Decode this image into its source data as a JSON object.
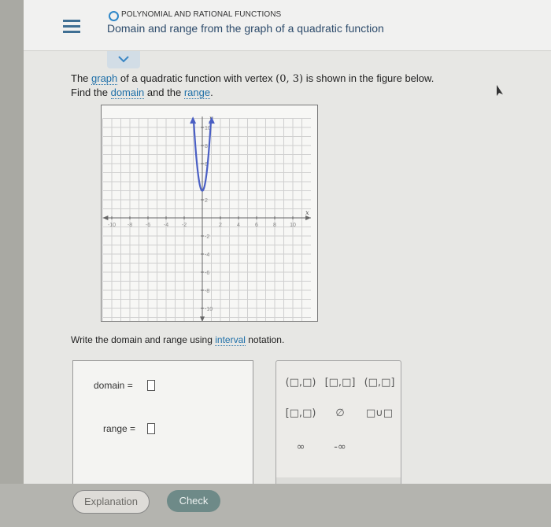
{
  "header": {
    "topic": "POLYNOMIAL AND RATIONAL FUNCTIONS",
    "title": "Domain and range from the graph of a quadratic function"
  },
  "question": {
    "line1_a": "The ",
    "graph_link": "graph",
    "line1_b": " of a quadratic function with vertex ",
    "vertex": "(0, 3)",
    "line1_c": " is shown in the figure below.",
    "line2_a": "Find the ",
    "domain_link": "domain",
    "line2_b": " and the ",
    "range_link": "range",
    "line2_c": "."
  },
  "graph": {
    "x_axis_label": "x",
    "y_axis_label": "y",
    "x_ticks": [
      "-10",
      "-8",
      "-6",
      "-4",
      "-2",
      "2",
      "4",
      "6",
      "8",
      "10"
    ],
    "y_ticks": [
      "10",
      "8",
      "6",
      "2",
      "-2",
      "-4",
      "-6",
      "-8",
      "-10"
    ],
    "vertex": [
      0,
      3
    ],
    "curve_color": "#4a5fc4"
  },
  "prompt": {
    "text_a": "Write the domain and range using ",
    "interval_link": "interval",
    "text_b": " notation."
  },
  "answers": {
    "domain_label": "domain =",
    "range_label": "range ="
  },
  "keypad": {
    "keys": [
      "(□,□)",
      "[□,□]",
      "(□,□]",
      "[□,□)",
      "∅",
      "□∪□",
      "∞",
      "-∞"
    ]
  },
  "buttons": {
    "explanation": "Explanation",
    "check": "Check"
  }
}
